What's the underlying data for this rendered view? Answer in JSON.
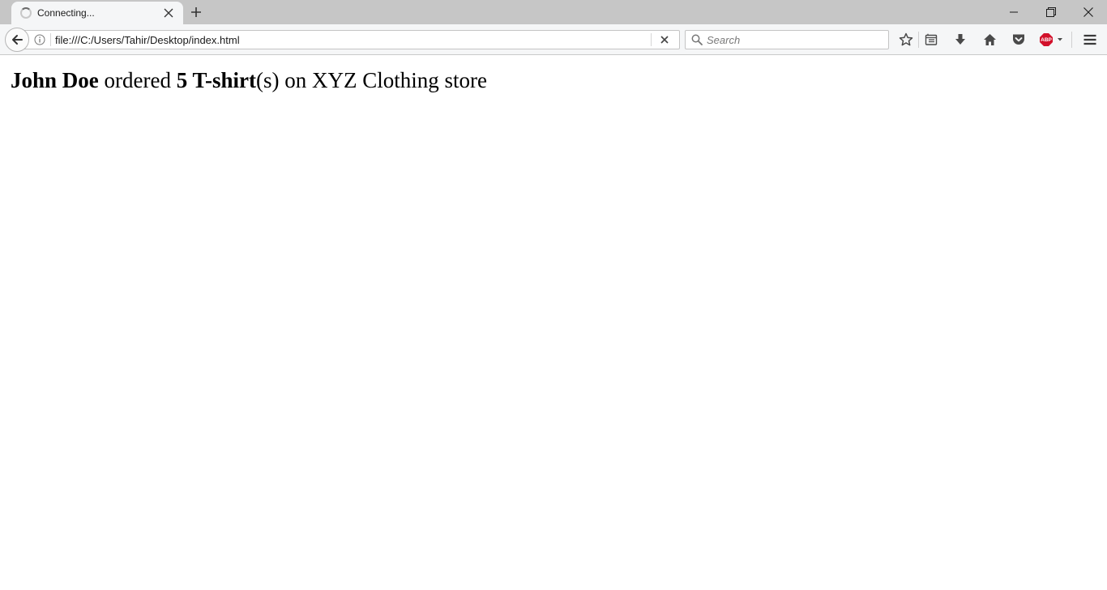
{
  "tab": {
    "title": "Connecting..."
  },
  "urlbar": {
    "value": "file:///C:/Users/Tahir/Desktop/index.html"
  },
  "search": {
    "placeholder": "Search"
  },
  "toolbar": {
    "icons": [
      "bookmark-star-icon",
      "reading-list-icon",
      "download-icon",
      "home-icon",
      "pocket-icon",
      "adblock-plus-icon",
      "menu-icon"
    ],
    "adblock_label": "ABP",
    "adblock_color": "#d2112b"
  },
  "page": {
    "customer": "John Doe",
    "verb": " ordered ",
    "quantity_product": "5 T-shirt",
    "suffix": "(s) on XYZ Clothing store"
  }
}
